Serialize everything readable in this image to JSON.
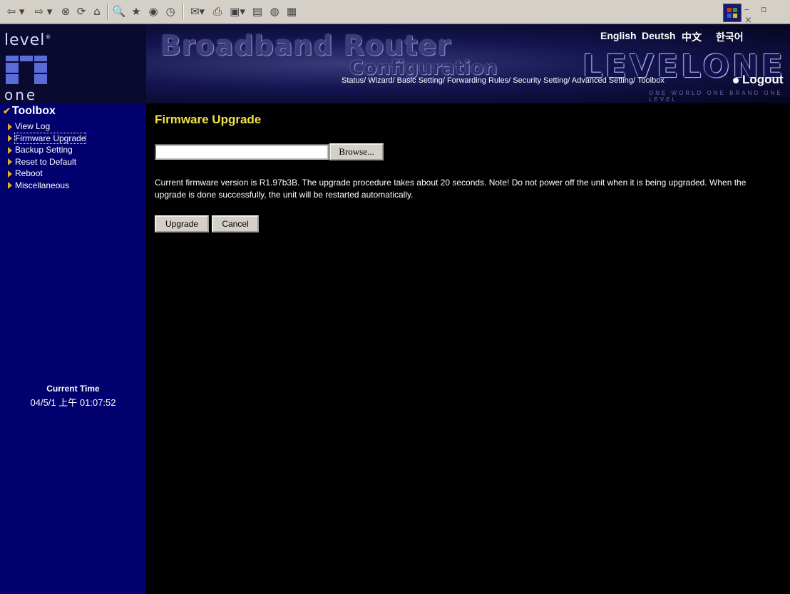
{
  "toolbar": {
    "icons": [
      "back-icon",
      "forward-icon",
      "stop-icon",
      "refresh-icon",
      "home-icon",
      "search-icon",
      "favorites-icon",
      "media-icon",
      "history-icon",
      "mail-icon",
      "print-icon",
      "edit-icon",
      "discuss-icon",
      "messenger-icon"
    ],
    "back_glyph": "⇦ ▾",
    "forward_glyph": "⇨ ▾",
    "stop_glyph": "⊗",
    "refresh_glyph": "⟳",
    "home_glyph": "⌂",
    "search_glyph": "🔍",
    "favorites_glyph": "★",
    "media_glyph": "◉",
    "history_glyph": "◷",
    "mail_glyph": "✉▾",
    "print_glyph": "⎙",
    "edit_glyph": "▣▾",
    "discuss_glyph": "▤",
    "messenger_glyph": "◍",
    "extra_glyph": "▦",
    "window_controls": "– ▫ ×"
  },
  "logo": {
    "top": "level",
    "reg": "®",
    "bottom": "one"
  },
  "banner": {
    "title": "Broadband Router",
    "subtitle": "Configuration",
    "brand": "LEVELONE",
    "slogan": "ONE WORLD  ONE BRAND  ONE LEVEL",
    "languages": [
      "English",
      "Deutsh",
      "中文",
      "한국어"
    ],
    "nav_links": "Status/ Wizard/ Basic Setting/ Forwarding Rules/ Security Setting/ Advanced Setting/ Toolbox",
    "logout": "Logout"
  },
  "sidebar": {
    "heading": "Toolbox",
    "items": [
      {
        "label": "View Log"
      },
      {
        "label": "Firmware Upgrade"
      },
      {
        "label": "Backup Setting"
      },
      {
        "label": "Reset to Default"
      },
      {
        "label": "Reboot"
      },
      {
        "label": "Miscellaneous"
      }
    ],
    "time_label": "Current Time",
    "time_value": "04/5/1 上午 01:07:52"
  },
  "main": {
    "title": "Firmware Upgrade",
    "file_value": "",
    "browse_label": "Browse...",
    "description": "Current firmware version is R1.97b3B. The upgrade procedure takes about 20 seconds. Note! Do not power off the unit when it is being upgraded. When the upgrade is done successfully, the unit will be restarted automatically.",
    "upgrade_label": "Upgrade",
    "cancel_label": "Cancel"
  },
  "colors": {
    "sidebar_bg": "#00006e",
    "title_yellow": "#f2e24a",
    "page_bg": "#000000"
  }
}
